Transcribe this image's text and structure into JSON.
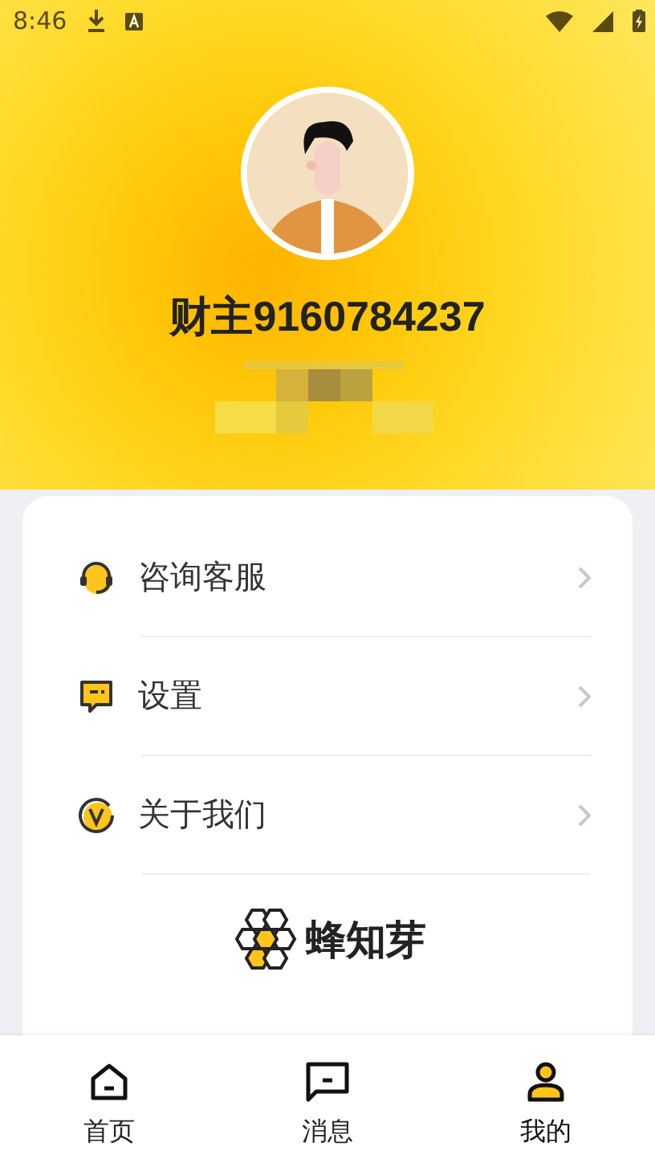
{
  "status_bar": {
    "time": "8:46"
  },
  "profile": {
    "name": "财主9160784237"
  },
  "menu": [
    {
      "kind": "headset",
      "label": "咨询客服"
    },
    {
      "kind": "chat",
      "label": "设置"
    },
    {
      "kind": "badge",
      "label": "关于我们"
    }
  ],
  "brand": {
    "name": "蜂知芽"
  },
  "tabs": [
    {
      "kind": "home",
      "label": "首页",
      "selected": false
    },
    {
      "kind": "message",
      "label": "消息",
      "selected": false
    },
    {
      "kind": "person",
      "label": "我的",
      "selected": true
    }
  ]
}
